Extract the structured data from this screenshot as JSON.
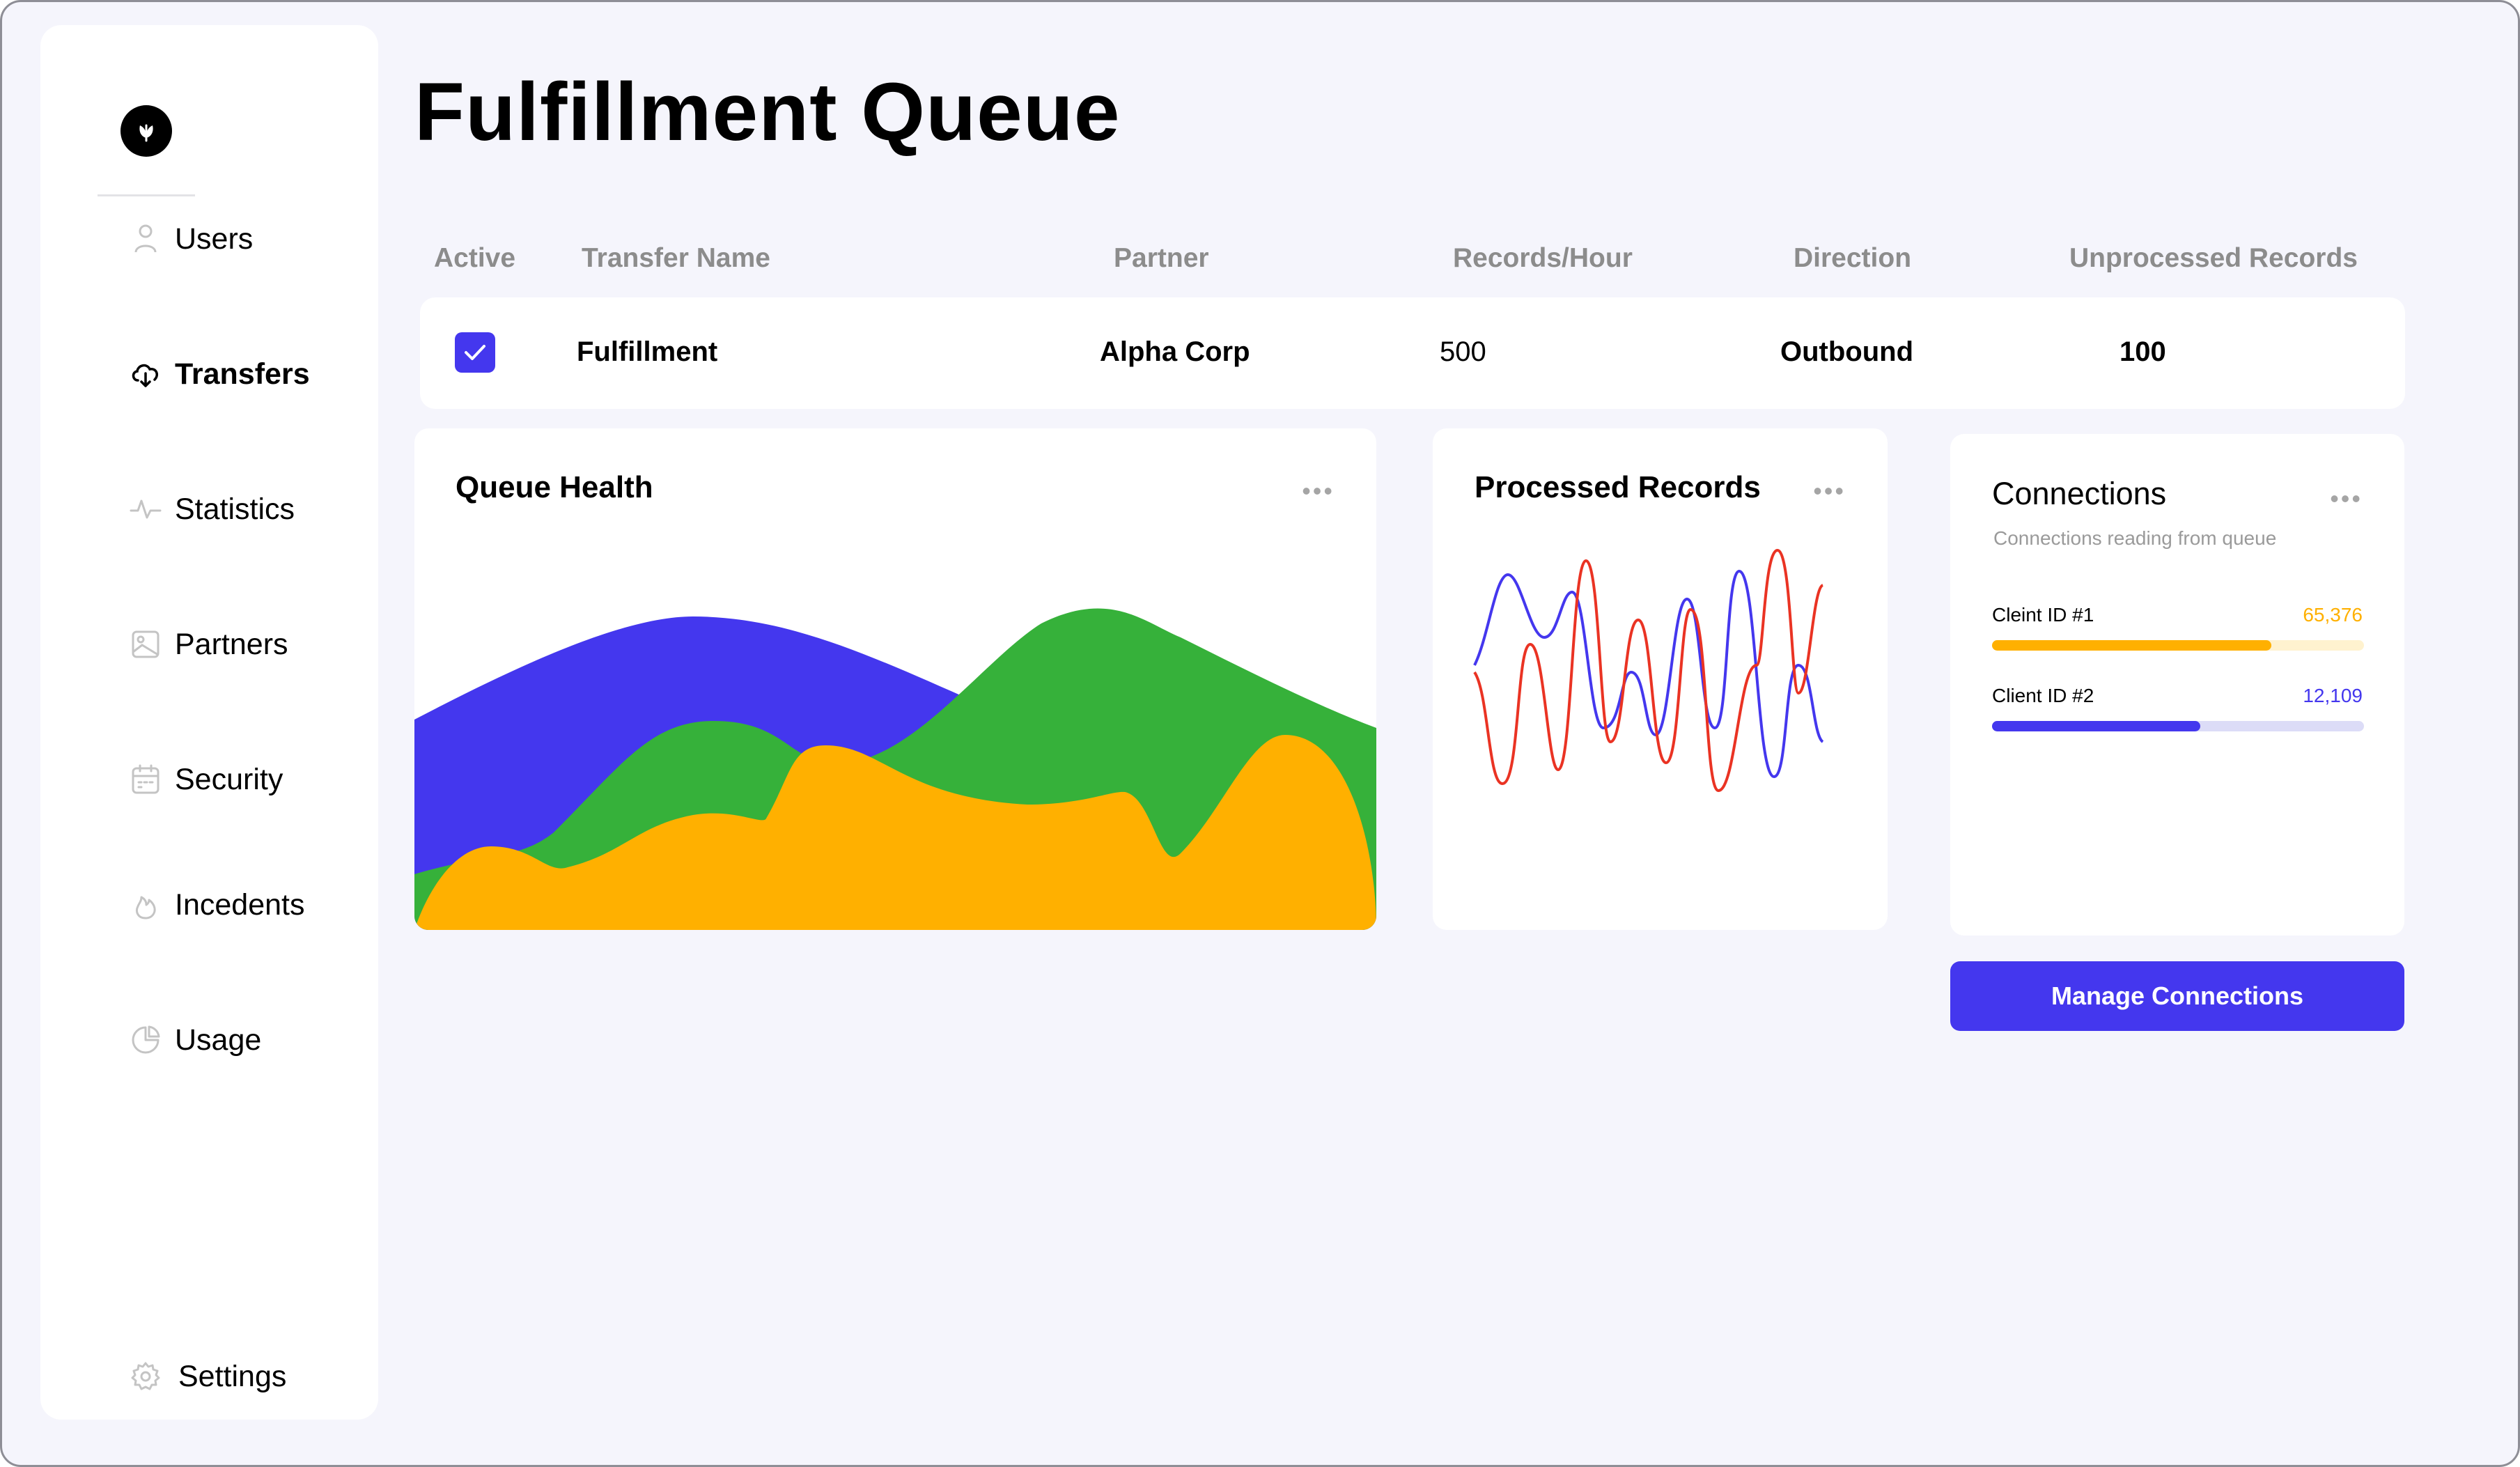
{
  "header": {
    "title": "Fulfillment Queue"
  },
  "sidebar": {
    "items": [
      {
        "label": "Users",
        "icon": "user-icon"
      },
      {
        "label": "Transfers",
        "icon": "cloud-download-icon",
        "active": true
      },
      {
        "label": "Statistics",
        "icon": "activity-icon"
      },
      {
        "label": "Partners",
        "icon": "image-icon"
      },
      {
        "label": "Security",
        "icon": "calendar-icon"
      },
      {
        "label": "Incedents",
        "icon": "flame-icon"
      },
      {
        "label": "Usage",
        "icon": "pie-chart-icon"
      }
    ],
    "settings": {
      "label": "Settings",
      "icon": "gear-icon"
    },
    "logo_icon": "leaf-logo-icon"
  },
  "table": {
    "columns": [
      "Active",
      "Transfer Name",
      "Partner",
      "Records/Hour",
      "Direction",
      "Unprocessed Records"
    ],
    "rows": [
      {
        "active": true,
        "transfer_name": "Fulfillment",
        "partner": "Alpha Corp",
        "records_per_hour": "500",
        "direction": "Outbound",
        "unprocessed": "100"
      }
    ]
  },
  "queue_health": {
    "title": "Queue Health",
    "colors": [
      "#4437EE",
      "#36B13A",
      "#FFB000"
    ]
  },
  "processed_records": {
    "title": "Processed Records",
    "colors": [
      "#4437EE",
      "#EA3323"
    ]
  },
  "connections": {
    "title": "Connections",
    "subtitle": "Connections reading from queue",
    "clients": [
      {
        "label": "Cleint ID #1",
        "value": "65,376",
        "fraction": 0.75,
        "color": "#FFB000",
        "track": "#FFF2CF"
      },
      {
        "label": "Client ID #2",
        "value": "12,109",
        "fraction": 0.56,
        "color": "#4437EE",
        "track": "#DCDCF7"
      }
    ]
  },
  "manage_button": {
    "label": "Manage Connections"
  },
  "colors": {
    "accent": "#4437EE",
    "background": "#F5F5FC"
  }
}
